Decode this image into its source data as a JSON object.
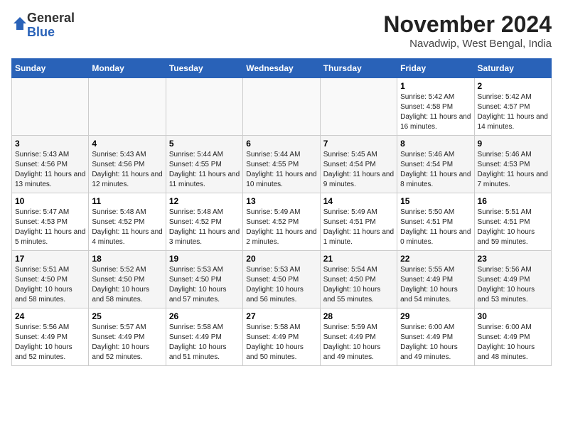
{
  "logo": {
    "general": "General",
    "blue": "Blue"
  },
  "title": "November 2024",
  "subtitle": "Navadwip, West Bengal, India",
  "days_of_week": [
    "Sunday",
    "Monday",
    "Tuesday",
    "Wednesday",
    "Thursday",
    "Friday",
    "Saturday"
  ],
  "weeks": [
    [
      {
        "day": "",
        "info": ""
      },
      {
        "day": "",
        "info": ""
      },
      {
        "day": "",
        "info": ""
      },
      {
        "day": "",
        "info": ""
      },
      {
        "day": "",
        "info": ""
      },
      {
        "day": "1",
        "info": "Sunrise: 5:42 AM\nSunset: 4:58 PM\nDaylight: 11 hours and 16 minutes."
      },
      {
        "day": "2",
        "info": "Sunrise: 5:42 AM\nSunset: 4:57 PM\nDaylight: 11 hours and 14 minutes."
      }
    ],
    [
      {
        "day": "3",
        "info": "Sunrise: 5:43 AM\nSunset: 4:56 PM\nDaylight: 11 hours and 13 minutes."
      },
      {
        "day": "4",
        "info": "Sunrise: 5:43 AM\nSunset: 4:56 PM\nDaylight: 11 hours and 12 minutes."
      },
      {
        "day": "5",
        "info": "Sunrise: 5:44 AM\nSunset: 4:55 PM\nDaylight: 11 hours and 11 minutes."
      },
      {
        "day": "6",
        "info": "Sunrise: 5:44 AM\nSunset: 4:55 PM\nDaylight: 11 hours and 10 minutes."
      },
      {
        "day": "7",
        "info": "Sunrise: 5:45 AM\nSunset: 4:54 PM\nDaylight: 11 hours and 9 minutes."
      },
      {
        "day": "8",
        "info": "Sunrise: 5:46 AM\nSunset: 4:54 PM\nDaylight: 11 hours and 8 minutes."
      },
      {
        "day": "9",
        "info": "Sunrise: 5:46 AM\nSunset: 4:53 PM\nDaylight: 11 hours and 7 minutes."
      }
    ],
    [
      {
        "day": "10",
        "info": "Sunrise: 5:47 AM\nSunset: 4:53 PM\nDaylight: 11 hours and 5 minutes."
      },
      {
        "day": "11",
        "info": "Sunrise: 5:48 AM\nSunset: 4:52 PM\nDaylight: 11 hours and 4 minutes."
      },
      {
        "day": "12",
        "info": "Sunrise: 5:48 AM\nSunset: 4:52 PM\nDaylight: 11 hours and 3 minutes."
      },
      {
        "day": "13",
        "info": "Sunrise: 5:49 AM\nSunset: 4:52 PM\nDaylight: 11 hours and 2 minutes."
      },
      {
        "day": "14",
        "info": "Sunrise: 5:49 AM\nSunset: 4:51 PM\nDaylight: 11 hours and 1 minute."
      },
      {
        "day": "15",
        "info": "Sunrise: 5:50 AM\nSunset: 4:51 PM\nDaylight: 11 hours and 0 minutes."
      },
      {
        "day": "16",
        "info": "Sunrise: 5:51 AM\nSunset: 4:51 PM\nDaylight: 10 hours and 59 minutes."
      }
    ],
    [
      {
        "day": "17",
        "info": "Sunrise: 5:51 AM\nSunset: 4:50 PM\nDaylight: 10 hours and 58 minutes."
      },
      {
        "day": "18",
        "info": "Sunrise: 5:52 AM\nSunset: 4:50 PM\nDaylight: 10 hours and 58 minutes."
      },
      {
        "day": "19",
        "info": "Sunrise: 5:53 AM\nSunset: 4:50 PM\nDaylight: 10 hours and 57 minutes."
      },
      {
        "day": "20",
        "info": "Sunrise: 5:53 AM\nSunset: 4:50 PM\nDaylight: 10 hours and 56 minutes."
      },
      {
        "day": "21",
        "info": "Sunrise: 5:54 AM\nSunset: 4:50 PM\nDaylight: 10 hours and 55 minutes."
      },
      {
        "day": "22",
        "info": "Sunrise: 5:55 AM\nSunset: 4:49 PM\nDaylight: 10 hours and 54 minutes."
      },
      {
        "day": "23",
        "info": "Sunrise: 5:56 AM\nSunset: 4:49 PM\nDaylight: 10 hours and 53 minutes."
      }
    ],
    [
      {
        "day": "24",
        "info": "Sunrise: 5:56 AM\nSunset: 4:49 PM\nDaylight: 10 hours and 52 minutes."
      },
      {
        "day": "25",
        "info": "Sunrise: 5:57 AM\nSunset: 4:49 PM\nDaylight: 10 hours and 52 minutes."
      },
      {
        "day": "26",
        "info": "Sunrise: 5:58 AM\nSunset: 4:49 PM\nDaylight: 10 hours and 51 minutes."
      },
      {
        "day": "27",
        "info": "Sunrise: 5:58 AM\nSunset: 4:49 PM\nDaylight: 10 hours and 50 minutes."
      },
      {
        "day": "28",
        "info": "Sunrise: 5:59 AM\nSunset: 4:49 PM\nDaylight: 10 hours and 49 minutes."
      },
      {
        "day": "29",
        "info": "Sunrise: 6:00 AM\nSunset: 4:49 PM\nDaylight: 10 hours and 49 minutes."
      },
      {
        "day": "30",
        "info": "Sunrise: 6:00 AM\nSunset: 4:49 PM\nDaylight: 10 hours and 48 minutes."
      }
    ]
  ]
}
